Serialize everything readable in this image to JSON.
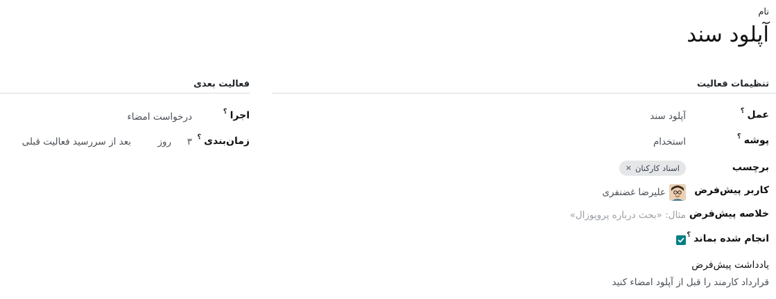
{
  "header": {
    "name_label": "نام",
    "name_value": "آپلود سند"
  },
  "activity_settings": {
    "title": "تنظیمات فعالیت",
    "action": {
      "label": "عمل",
      "help": "؟",
      "value": "آپلود سند"
    },
    "folder": {
      "label": "پوشه",
      "help": "؟",
      "value": "استخدام"
    },
    "tags": {
      "label": "برچسب",
      "items": [
        {
          "text": "اسناد کارکنان",
          "remove": "×"
        }
      ]
    },
    "default_user": {
      "label": "کاربر پیش‌فرض",
      "value": "علیرضا غضنفری",
      "avatar_icon": "user-avatar-icon"
    },
    "default_summary": {
      "label": "خلاصه پیش‌فرض",
      "placeholder": "مثال: «بحث درباره پروپوزال»"
    },
    "keep_done": {
      "label": "انجام شده بماند",
      "help": "؟",
      "checked": true
    },
    "default_note": {
      "label": "یادداشت پیش‌فرض",
      "value": "قرارداد کارمند را قبل از آپلود امضاء کنید"
    }
  },
  "next_activity": {
    "title": "فعالیت بعدی",
    "trigger": {
      "label": "اجرا",
      "help": "؟",
      "value": "درخواست امضاء"
    },
    "schedule": {
      "label": "زمان‌بندی",
      "help": "؟",
      "number": "۳",
      "unit": "روز",
      "relation": "بعد از سررسید فعالیت قبلی"
    }
  },
  "colors": {
    "accent": "#017e84",
    "tag_bg": "#e5e6e8",
    "divider": "#d8dadd"
  }
}
